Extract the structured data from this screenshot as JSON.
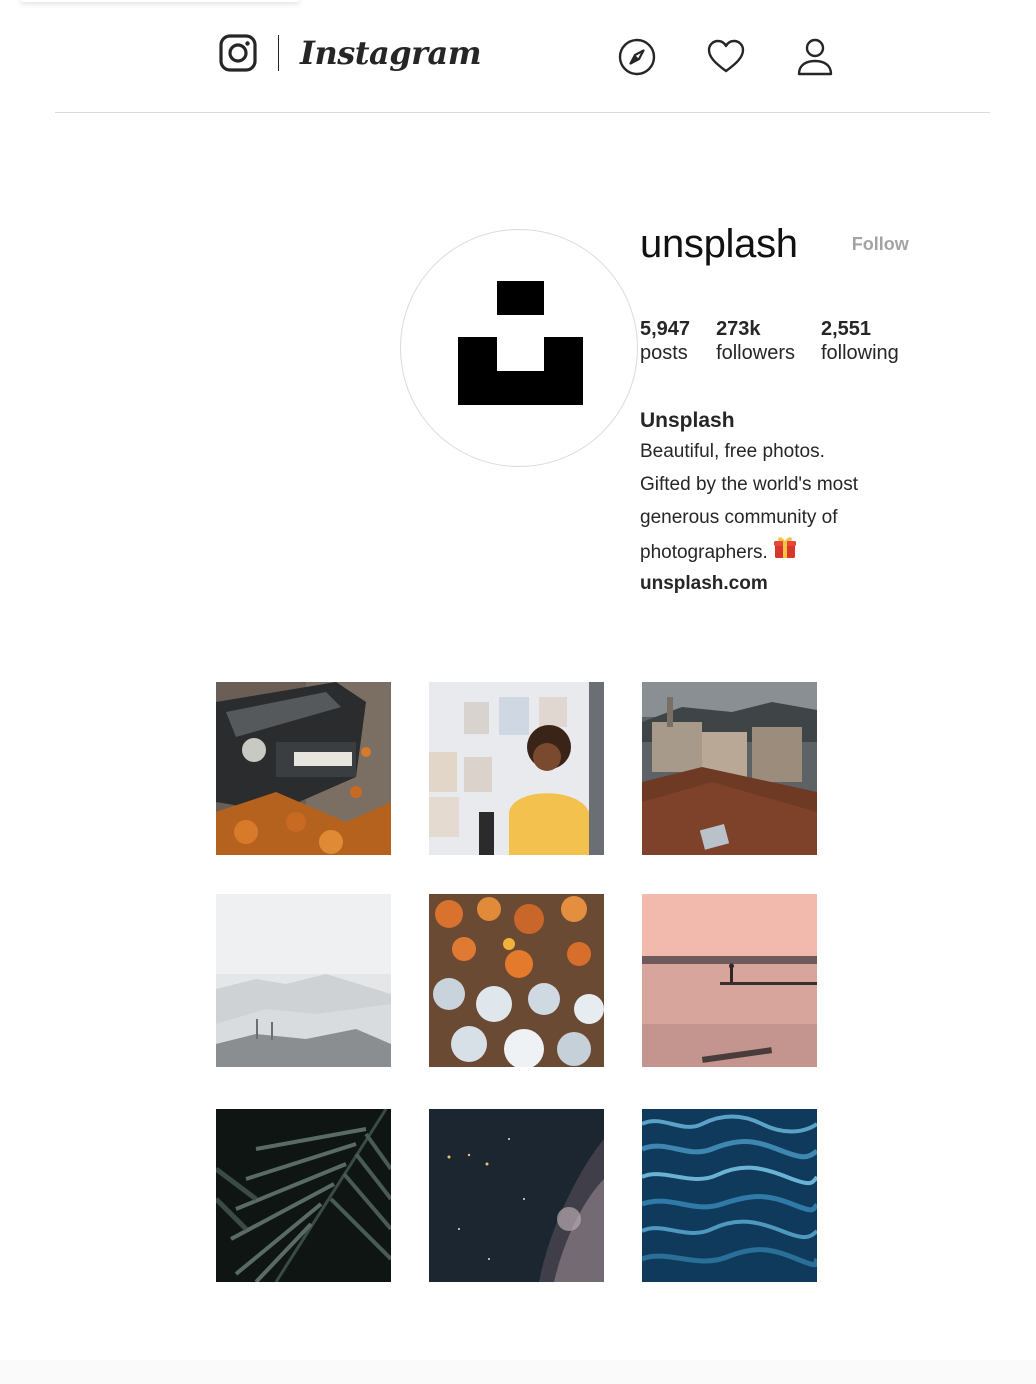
{
  "header": {
    "wordmark": "Instagram",
    "nav_icons": [
      "explore-icon",
      "activity-heart-icon",
      "profile-icon"
    ]
  },
  "profile": {
    "username": "unsplash",
    "follow_label": "Follow",
    "stats": [
      {
        "value": "5,947",
        "label": "posts"
      },
      {
        "value": "273k",
        "label": "followers"
      },
      {
        "value": "2,551",
        "label": "following"
      }
    ],
    "full_name": "Unsplash",
    "bio_lines": [
      "Beautiful, free photos.",
      "Gifted by the world's most",
      "generous community of",
      "photographers."
    ],
    "bio_emoji": "gift-icon",
    "website": "unsplash.com"
  },
  "grid": {
    "posts": [
      {
        "subject": "vintage car with autumn leaves"
      },
      {
        "subject": "woman on phone with photos on wall"
      },
      {
        "subject": "rooftops of hillside town"
      },
      {
        "subject": "misty mountains"
      },
      {
        "subject": "orange and white wildflowers"
      },
      {
        "subject": "paddleboarder on pink lake at dusk"
      },
      {
        "subject": "dark palm fronds"
      },
      {
        "subject": "night sky milky way"
      },
      {
        "subject": "blue rippling water"
      }
    ]
  },
  "colors": {
    "text": "#262626",
    "follow": "#a3a3a3",
    "divider": "#dbdbdb"
  }
}
